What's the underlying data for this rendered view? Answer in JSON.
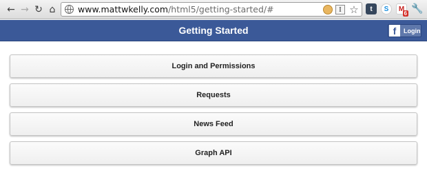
{
  "browser": {
    "url_domain": "www.mattwkelly.com",
    "url_path": "/html5/getting-started/#",
    "back_icon": "←",
    "forward_icon": "→",
    "reload_icon": "↻",
    "home_icon": "⌂",
    "reader_glyph": "I",
    "star_glyph": "☆",
    "tumblr_glyph": "t",
    "skype_glyph": "S",
    "gmail_glyph": "M",
    "gmail_count": "6",
    "wrench_glyph": "🔧"
  },
  "header": {
    "title": "Getting Started",
    "login_icon_glyph": "f",
    "login_label": "Login",
    "color": "#3b5998"
  },
  "menu": {
    "items": [
      {
        "label": "Login and Permissions"
      },
      {
        "label": "Requests"
      },
      {
        "label": "News Feed"
      },
      {
        "label": "Graph API"
      }
    ]
  }
}
